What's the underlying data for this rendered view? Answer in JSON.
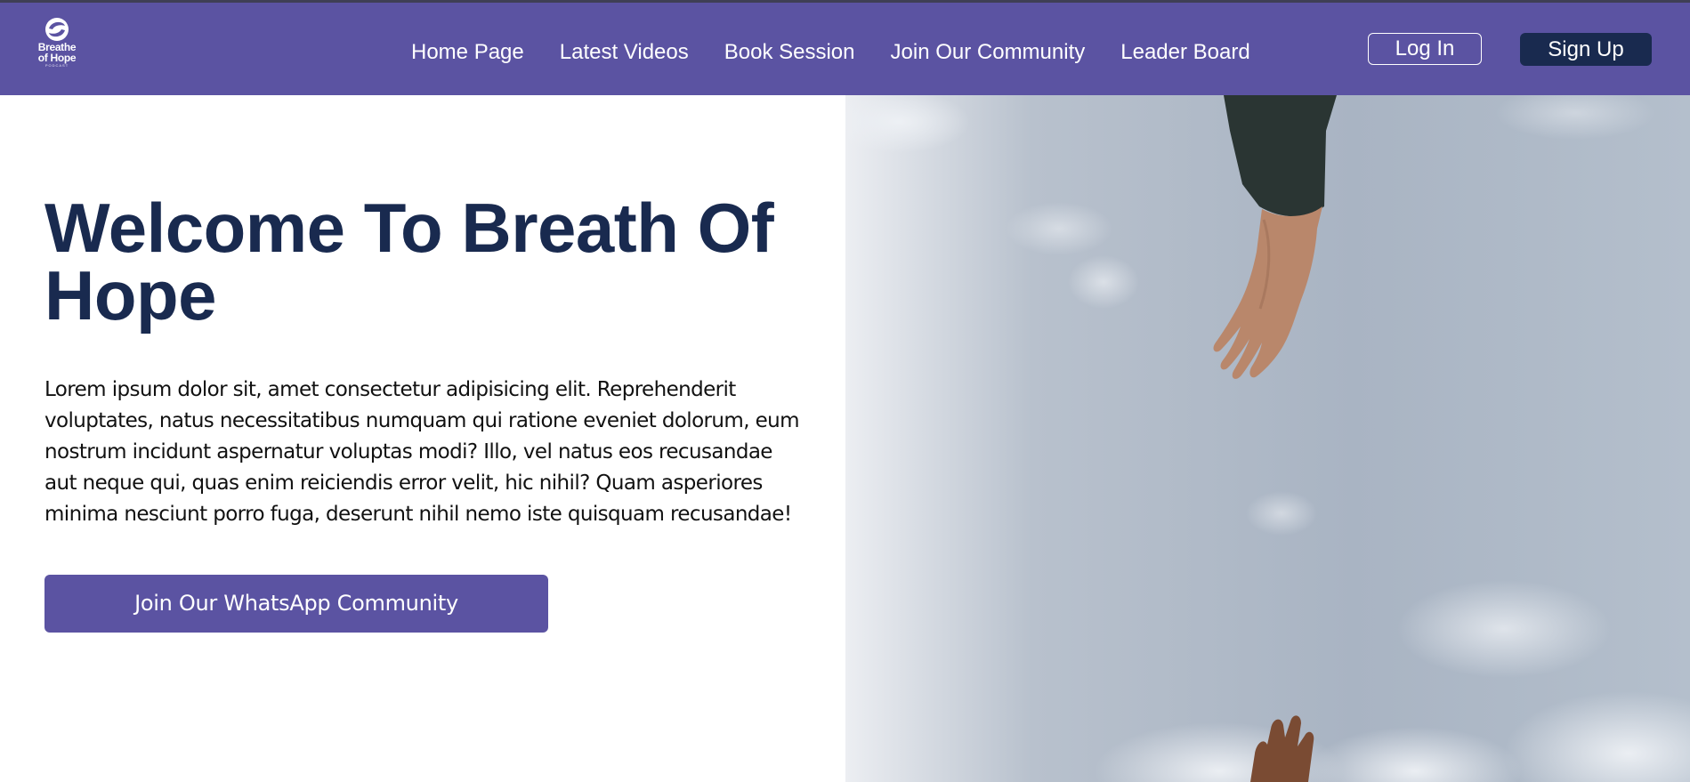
{
  "navbar": {
    "logo": {
      "line1": "Breathe",
      "line2": "of Hope",
      "tagline": "PODCAST",
      "icon": "swirl-logo-icon"
    },
    "links": [
      {
        "label": "Home Page"
      },
      {
        "label": "Latest Videos"
      },
      {
        "label": "Book Session"
      },
      {
        "label": "Join Our Community"
      },
      {
        "label": "Leader Board"
      }
    ],
    "login_label": "Log In",
    "signup_label": "Sign Up"
  },
  "hero": {
    "title": "Welcome To Breath Of Hope",
    "body": "Lorem ipsum dolor sit, amet consectetur adipisicing elit. Reprehenderit voluptates, natus necessitatibus numquam qui ratione eveniet dolorum, eum nostrum incidunt aspernatur voluptas modi? Illo, vel natus eos recusandae aut neque qui, quas enim reiciendis error velit, hic nihil? Quam asperiores minima nesciunt porro fuga, deserunt nihil nemo iste quisquam recusandae!",
    "cta_label": "Join Our WhatsApp Community",
    "image": "reaching-hands-sky-image"
  },
  "colors": {
    "brand_purple": "#5b53a2",
    "navy": "#192a4f",
    "white": "#ffffff"
  }
}
